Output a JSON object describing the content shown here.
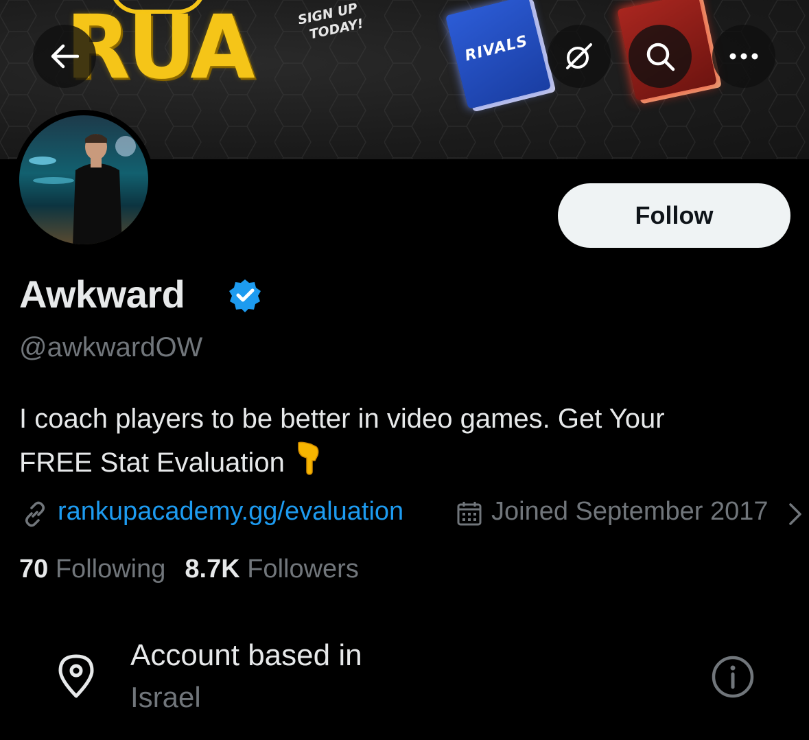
{
  "banner": {
    "logo_text": "RUA",
    "signup_line1": "SIGN UP",
    "signup_line2": "TODAY!",
    "book_left_label": "RIVALS"
  },
  "header_buttons": {
    "back_icon": "arrow-left-icon",
    "grok_icon": "grok-icon",
    "search_icon": "search-icon",
    "more_icon": "more-horizontal-icon"
  },
  "profile": {
    "display_name": "Awkward",
    "handle": "@awkwardOW",
    "follow_label": "Follow",
    "bio_line1": "I coach players to be better in video games. Get Your",
    "bio_line2": "FREE Stat Evaluation",
    "bio_emoji": "👇",
    "website": "rankupacademy.gg/evaluation",
    "joined": "Joined September 2017",
    "following_count": "70",
    "following_label": "Following",
    "followers_count": "8.7K",
    "followers_label": "Followers"
  },
  "about": {
    "title": "Account based in",
    "value": "Israel"
  },
  "colors": {
    "background": "#000000",
    "link": "#1d9bf0",
    "verified": "#1d9bf0",
    "secondary_text": "#71767b",
    "primary_text": "#e7e9ea",
    "follow_bg": "#eff3f4"
  }
}
